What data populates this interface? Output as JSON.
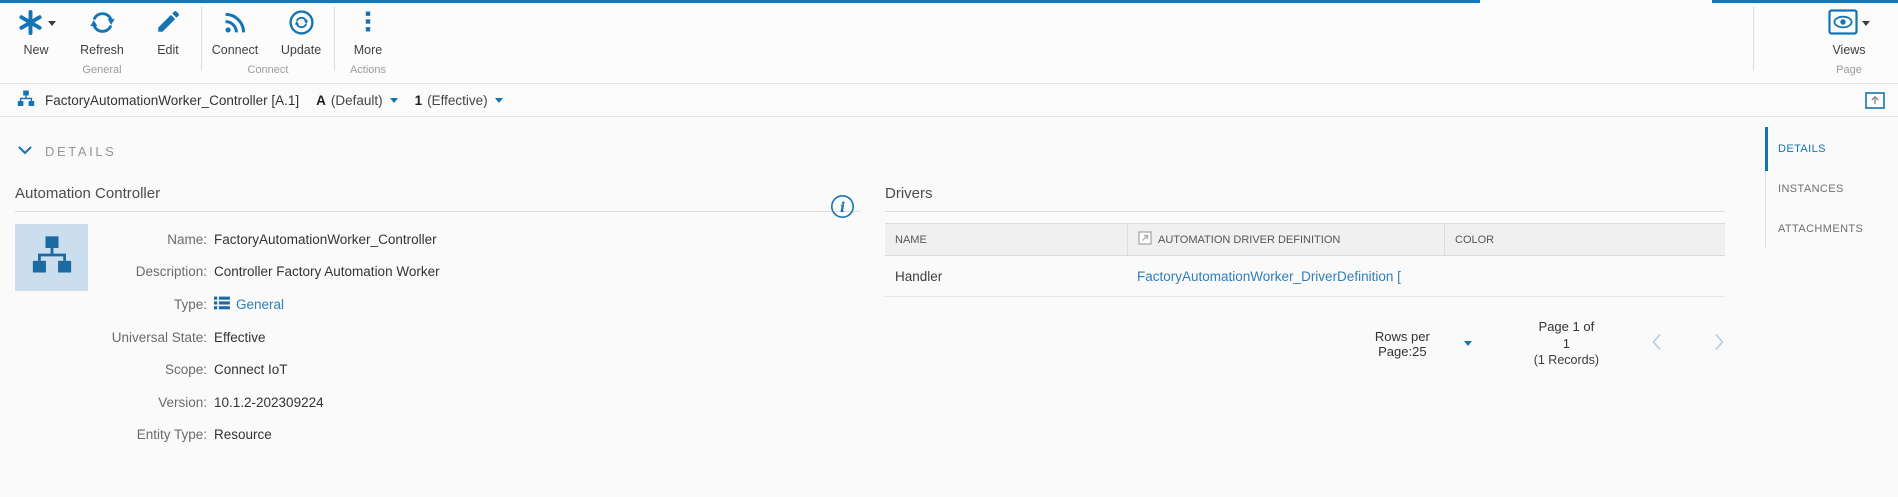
{
  "colors": {
    "accent_line": "#1377c0",
    "icon_blue": "#1575b4",
    "link_blue": "#2e7fbe",
    "active_tab_blue": "#1373b5",
    "driver_color_swatch": "#1ec9da"
  },
  "toolbar": {
    "buttons": {
      "new": "New",
      "refresh": "Refresh",
      "edit": "Edit",
      "connect": "Connect",
      "update": "Update",
      "more": "More",
      "views": "Views"
    },
    "groups": [
      {
        "label": "General"
      },
      {
        "label": "Connect"
      },
      {
        "label": "Actions"
      },
      {
        "label": "Page"
      }
    ]
  },
  "breadcrumb": {
    "entity": "FactoryAutomationWorker_Controller [A.1]",
    "variant": "A",
    "variant_label": "(Default)",
    "version": "1",
    "version_label": "(Effective)"
  },
  "section": {
    "title": "DETAILS"
  },
  "controller_panel": {
    "title": "Automation Controller",
    "fields": [
      {
        "label": "Name:",
        "value": "FactoryAutomationWorker_Controller"
      },
      {
        "label": "Description:",
        "value": "Controller Factory Automation Worker"
      },
      {
        "label": "Type:",
        "value": "General"
      },
      {
        "label": "Universal State:",
        "value": "Effective"
      },
      {
        "label": "Scope:",
        "value": "Connect IoT"
      },
      {
        "label": "Version:",
        "value": "10.1.2-202309224"
      },
      {
        "label": "Entity Type:",
        "value": "Resource"
      }
    ]
  },
  "drivers_panel": {
    "title": "Drivers",
    "columns": [
      "NAME",
      "AUTOMATION DRIVER DEFINITION",
      "COLOR"
    ],
    "rows": [
      {
        "name": "Handler",
        "driver_definition": "FactoryAutomationWorker_DriverDefinition [",
        "color": "#1ec9da"
      }
    ],
    "pagination": {
      "rows_per_page_label": "Rows per Page:",
      "rows_per_page_value": "25",
      "page_info": "Page 1 of 1",
      "records_info": "(1 Records)"
    }
  },
  "side_tabs": [
    {
      "label": "DETAILS"
    },
    {
      "label": "INSTANCES"
    },
    {
      "label": "ATTACHMENTS"
    }
  ]
}
